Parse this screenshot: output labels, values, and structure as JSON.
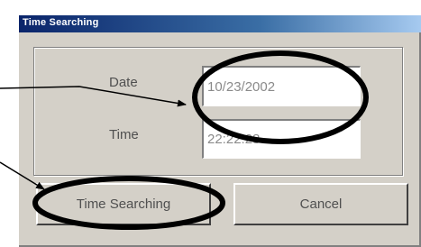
{
  "dialog": {
    "title": "Time Searching"
  },
  "form": {
    "date_label": "Date",
    "date_value": "10/23/2002",
    "time_label": "Time",
    "time_value": "22:22:28"
  },
  "buttons": {
    "search_label": "Time Searching",
    "cancel_label": "Cancel"
  },
  "annotation_color": "#000000"
}
